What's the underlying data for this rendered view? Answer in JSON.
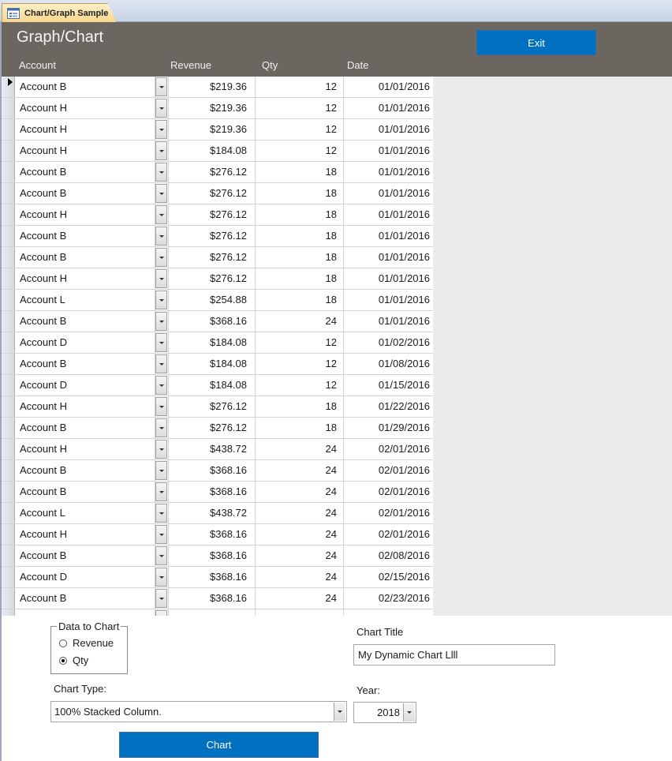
{
  "tab": {
    "label": "Chart/Graph Sample",
    "icon": "form-icon"
  },
  "header": {
    "title": "Graph/Chart",
    "exit_label": "Exit",
    "columns": {
      "account": "Account",
      "revenue": "Revenue",
      "qty": "Qty",
      "date": "Date"
    }
  },
  "rows": [
    {
      "account": "Account B",
      "revenue": "$219.36",
      "qty": "12",
      "date": "01/01/2016"
    },
    {
      "account": "Account H",
      "revenue": "$219.36",
      "qty": "12",
      "date": "01/01/2016"
    },
    {
      "account": "Account H",
      "revenue": "$219.36",
      "qty": "12",
      "date": "01/01/2016"
    },
    {
      "account": "Account H",
      "revenue": "$184.08",
      "qty": "12",
      "date": "01/01/2016"
    },
    {
      "account": "Account B",
      "revenue": "$276.12",
      "qty": "18",
      "date": "01/01/2016"
    },
    {
      "account": "Account B",
      "revenue": "$276.12",
      "qty": "18",
      "date": "01/01/2016"
    },
    {
      "account": "Account H",
      "revenue": "$276.12",
      "qty": "18",
      "date": "01/01/2016"
    },
    {
      "account": "Account B",
      "revenue": "$276.12",
      "qty": "18",
      "date": "01/01/2016"
    },
    {
      "account": "Account B",
      "revenue": "$276.12",
      "qty": "18",
      "date": "01/01/2016"
    },
    {
      "account": "Account H",
      "revenue": "$276.12",
      "qty": "18",
      "date": "01/01/2016"
    },
    {
      "account": "Account L",
      "revenue": "$254.88",
      "qty": "18",
      "date": "01/01/2016"
    },
    {
      "account": "Account B",
      "revenue": "$368.16",
      "qty": "24",
      "date": "01/01/2016"
    },
    {
      "account": "Account D",
      "revenue": "$184.08",
      "qty": "12",
      "date": "01/02/2016"
    },
    {
      "account": "Account B",
      "revenue": "$184.08",
      "qty": "12",
      "date": "01/08/2016"
    },
    {
      "account": "Account D",
      "revenue": "$184.08",
      "qty": "12",
      "date": "01/15/2016"
    },
    {
      "account": "Account H",
      "revenue": "$276.12",
      "qty": "18",
      "date": "01/22/2016"
    },
    {
      "account": "Account B",
      "revenue": "$276.12",
      "qty": "18",
      "date": "01/29/2016"
    },
    {
      "account": "Account H",
      "revenue": "$438.72",
      "qty": "24",
      "date": "02/01/2016"
    },
    {
      "account": "Account B",
      "revenue": "$368.16",
      "qty": "24",
      "date": "02/01/2016"
    },
    {
      "account": "Account B",
      "revenue": "$368.16",
      "qty": "24",
      "date": "02/01/2016"
    },
    {
      "account": "Account L",
      "revenue": "$438.72",
      "qty": "24",
      "date": "02/01/2016"
    },
    {
      "account": "Account H",
      "revenue": "$368.16",
      "qty": "24",
      "date": "02/01/2016"
    },
    {
      "account": "Account B",
      "revenue": "$368.16",
      "qty": "24",
      "date": "02/08/2016"
    },
    {
      "account": "Account D",
      "revenue": "$368.16",
      "qty": "24",
      "date": "02/15/2016"
    },
    {
      "account": "Account B",
      "revenue": "$368.16",
      "qty": "24",
      "date": "02/23/2016"
    },
    {
      "account": "",
      "revenue": "",
      "qty": "",
      "date": ""
    }
  ],
  "options": {
    "group_label": "Data to Chart",
    "items": [
      {
        "label": "Revenue",
        "selected": false
      },
      {
        "label": "Qty",
        "selected": true
      }
    ]
  },
  "chart_title": {
    "label": "Chart Title",
    "value": "My Dynamic Chart Llll"
  },
  "chart_type": {
    "label": "Chart Type:",
    "value": "100% Stacked Column."
  },
  "year": {
    "label": "Year:",
    "value": "2018"
  },
  "chart_button_label": "Chart",
  "colors": {
    "header_bg": "#6b6660",
    "button_blue": "#0070c0",
    "tab_gold": "#f6d68c"
  }
}
